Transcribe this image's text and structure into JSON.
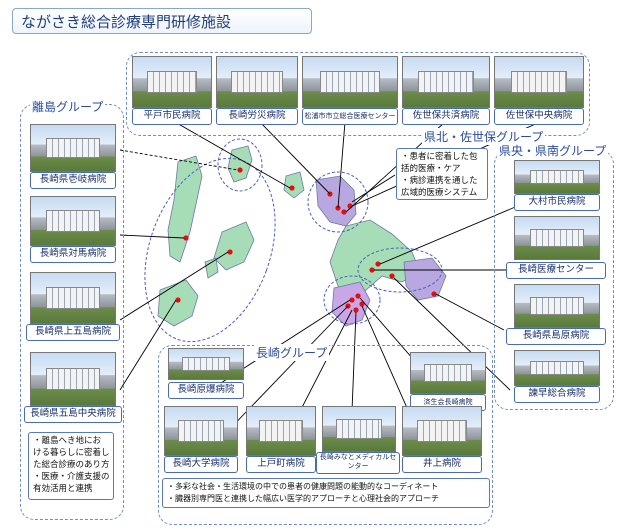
{
  "title": "ながさき総合診療専門研修施設",
  "groups": {
    "ritou": "離島グループ",
    "kenhoku": "県北・佐世保グループ",
    "kennan": "県央・県南グループ",
    "nagasaki": "長崎グループ"
  },
  "hospitals": {
    "hirado": "平戸市民病院",
    "rousai": "長崎労災病院",
    "matsuura": "松浦市市立総合医療センター",
    "kyosai": "佐世保共済病院",
    "sasebo_chuo": "佐世保中央病院",
    "iki": "長崎県壱岐病院",
    "tsushima": "長崎県対馬病院",
    "kamigoto": "長崎県上五島病院",
    "goto_chuo": "長崎県五島中央病院",
    "omura": "大村市民病院",
    "iryo_center": "長崎医療センター",
    "shimabara": "長崎県島原病院",
    "isahaya": "諫早総合病院",
    "genbaku": "長崎原爆病院",
    "kin_kyo": "済生会長崎病院",
    "daigaku": "長崎大学病院",
    "kamimachi": "上戸町病院",
    "minato": "長崎みなとメディカルセンター",
    "inoue": "井上病院"
  },
  "notes": {
    "kenhoku": [
      "・患者に密着した包",
      "括的医療・ケア",
      "・病診連携を通した",
      "広域的医療システム"
    ],
    "ritou": [
      "・離島へき地にお",
      "ける暮らしに密着し",
      "た総合診療のあり方",
      "・医療・介護支援の",
      "有効活用と連携"
    ],
    "nagasaki": [
      "・多彩な社会・生活環境の中での患者の健康問題の能動的なコーディネート",
      "・臓器別専門医と連携した幅広い医学的アプローチと心理社会的アプローチ"
    ]
  },
  "colors": {
    "label_border": "#4a6bb0",
    "group_border": "#6e8fc4",
    "leader": "#000000",
    "marker": "#e01010",
    "land": "#a7ddb6"
  }
}
